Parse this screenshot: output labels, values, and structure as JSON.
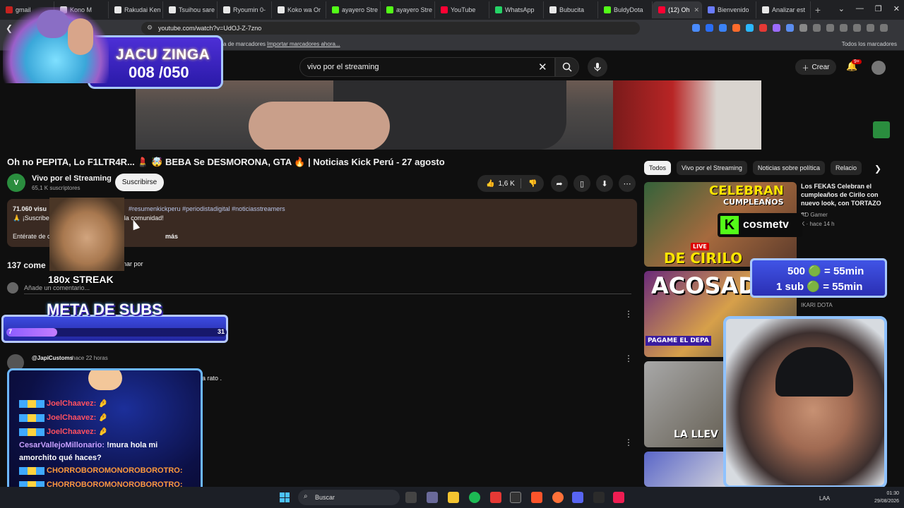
{
  "browser": {
    "tabs": [
      {
        "label": "gmail",
        "color": "#c5221f"
      },
      {
        "label": "Kono M",
        "color": "#e8e8e8"
      },
      {
        "label": "Rakudai Ken",
        "color": "#e8e8e8"
      },
      {
        "label": "Tsuihou sare",
        "color": "#e8e8e8"
      },
      {
        "label": "Ryoumin 0-",
        "color": "#e8e8e8"
      },
      {
        "label": "Koko wa Or",
        "color": "#e8e8e8"
      },
      {
        "label": "ayayero Stre",
        "color": "#53fc18"
      },
      {
        "label": "ayayero Stre",
        "color": "#53fc18"
      },
      {
        "label": "YouTube",
        "color": "#ff0033"
      },
      {
        "label": "WhatsApp",
        "color": "#25d366"
      },
      {
        "label": "Bubucita",
        "color": "#e8e8e8"
      },
      {
        "label": "BuldyDota",
        "color": "#53fc18"
      },
      {
        "label": "(12) Oh",
        "color": "#ff0033",
        "active": true
      },
      {
        "label": "Bienvenido",
        "color": "#6a7cff"
      },
      {
        "label": "Analizar est",
        "color": "#e8e8e8"
      }
    ],
    "url": "youtube.com/watch?v=UdOJ-Z-7zno",
    "bookmarks_text": "a de marcadores",
    "bookmarks_link": "Importar marcadores ahora...",
    "bookmarks_all": "Todos los marcadores"
  },
  "youtube": {
    "search_value": "vivo por el streaming",
    "create_label": "Crear",
    "notif_badge": "9+",
    "video_title": "Oh no PEPITA, Lo F1LTR4R... 💄 🤯 BEBA Se DESMORONA, GTA 🔥 | Noticias Kick Perú - 27 agosto",
    "channel_name": "Vivo por el Streaming",
    "channel_initials": "V",
    "channel_subs": "65,1 K suscriptores",
    "subscribe_label": "Suscribirse",
    "likes": "1,6 K",
    "description": {
      "views": "71.060 visu",
      "tags": "#resumenkickperu #periodistadigital #noticiasstreamers",
      "line2": "🙏 ¡Suscribe                                  con lo más importante de la comunidad!",
      "line3": "Entérate de                                      deo de HOY",
      "more": "más"
    },
    "comments_count": "137 come",
    "sort_by": "nar por",
    "comment_placeholder": "Añade un comentario...",
    "comment_author": "@JapiCustoms",
    "comment_time": "hace 22 horas",
    "comment_tail": "da rato ."
  },
  "sidebar": {
    "chips": [
      {
        "label": "Todos",
        "active": true
      },
      {
        "label": "Vivo por el Streaming",
        "active": false
      },
      {
        "label": "Noticias sobre política",
        "active": false
      },
      {
        "label": "Relacio",
        "active": false
      }
    ],
    "rec1_title": "Los FEKAS Celebran el cumpleaños de Cirilo con nuevo look, con TORTAZO ...",
    "rec1_channel": "AD Gamer",
    "rec1_meta": "K · hace 14 h",
    "rec2_channel": "IKARI DOTA",
    "thumb1_text_top": "CELEBRAN",
    "thumb1_text_sub": "CUMPLEAÑOS",
    "thumb1_badge": "LIVE",
    "thumb1_text_bottom": "DE CIRILO",
    "thumb2_text": "ACOSAD",
    "thumb2_text_sub": "PAGAME EL DEPA",
    "thumb3_text": "LA LLEV"
  },
  "overlay": {
    "jacu_title": "JACU ZINGA",
    "jacu_count": "008 /050",
    "streak": "180x STREAK",
    "meta_title": "META DE SUBS",
    "meta_start": "7",
    "meta_end": "31",
    "meta_progress": 0.23,
    "kick_name": "cosmetv",
    "goal_line1": "500 🟢 = 55min",
    "goal_line2": "1 sub 🟢 = 55min",
    "chat": [
      {
        "user": "JoelChaavez:",
        "msg": " 🤌",
        "style": "red"
      },
      {
        "user": "JoelChaavez:",
        "msg": " 🤌",
        "style": "red"
      },
      {
        "user": "JoelChaavez:",
        "msg": " 🤌",
        "style": "red"
      },
      {
        "user": "CesarVallejoMillonario:",
        "msg": " !mura hola mi",
        "style": "green"
      },
      {
        "user": "",
        "msg": "amorchito qué haces?",
        "style": "plain"
      },
      {
        "user": "CHORROBOROMONOROBOROTRO:",
        "msg": "",
        "style": "orange"
      },
      {
        "user": "CHORROBOROMONOROBOROTRO:",
        "msg": "",
        "style": "orange"
      }
    ]
  },
  "taskbar": {
    "search_placeholder": "Buscar",
    "lang": "LAA",
    "time": "01:30",
    "date": "29/08/2026"
  }
}
